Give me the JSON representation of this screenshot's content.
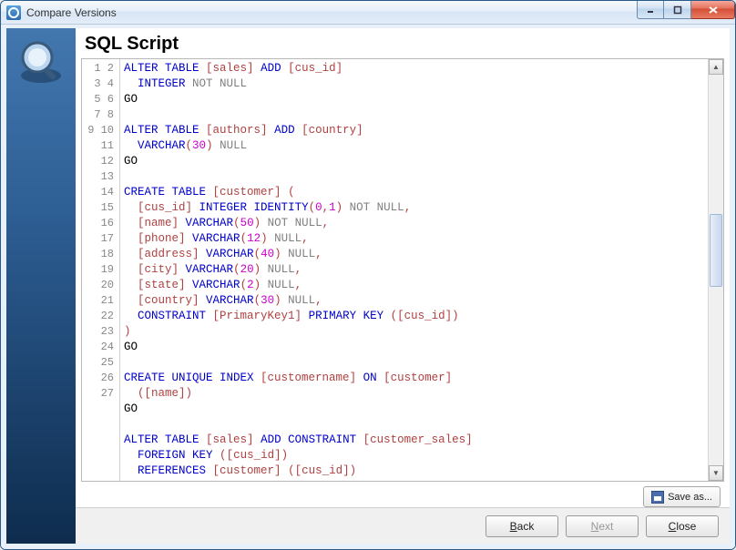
{
  "window": {
    "title": "Compare Versions"
  },
  "heading": "SQL Script",
  "buttons": {
    "save_as": "Save as...",
    "back": "Back",
    "next": "Next",
    "close": "Close"
  },
  "code_lines": [
    [
      [
        "kw",
        "ALTER TABLE"
      ],
      [
        "",
        " "
      ],
      [
        "br",
        "[sales]"
      ],
      [
        "",
        " "
      ],
      [
        "kw",
        "ADD"
      ],
      [
        "",
        " "
      ],
      [
        "br",
        "[cus_id]"
      ]
    ],
    [
      [
        "",
        "  "
      ],
      [
        "kw",
        "INTEGER"
      ],
      [
        "",
        " "
      ],
      [
        "gray",
        "NOT NULL"
      ]
    ],
    [
      [
        "",
        "GO"
      ]
    ],
    [],
    [
      [
        "kw",
        "ALTER TABLE"
      ],
      [
        "",
        " "
      ],
      [
        "br",
        "[authors]"
      ],
      [
        "",
        " "
      ],
      [
        "kw",
        "ADD"
      ],
      [
        "",
        " "
      ],
      [
        "br",
        "[country]"
      ]
    ],
    [
      [
        "",
        "  "
      ],
      [
        "kw",
        "VARCHAR"
      ],
      [
        "op",
        "("
      ],
      [
        "num",
        "30"
      ],
      [
        "op",
        ")"
      ],
      [
        "",
        " "
      ],
      [
        "gray",
        "NULL"
      ]
    ],
    [
      [
        "",
        "GO"
      ]
    ],
    [],
    [
      [
        "kw",
        "CREATE TABLE"
      ],
      [
        "",
        " "
      ],
      [
        "br",
        "[customer]"
      ],
      [
        "",
        " "
      ],
      [
        "op",
        "("
      ]
    ],
    [
      [
        "",
        "  "
      ],
      [
        "br",
        "[cus_id]"
      ],
      [
        "",
        " "
      ],
      [
        "kw",
        "INTEGER IDENTITY"
      ],
      [
        "op",
        "("
      ],
      [
        "num",
        "0"
      ],
      [
        "op",
        ","
      ],
      [
        "num",
        "1"
      ],
      [
        "op",
        ")"
      ],
      [
        "",
        " "
      ],
      [
        "gray",
        "NOT NULL"
      ],
      [
        "op",
        ","
      ]
    ],
    [
      [
        "",
        "  "
      ],
      [
        "br",
        "[name]"
      ],
      [
        "",
        " "
      ],
      [
        "kw",
        "VARCHAR"
      ],
      [
        "op",
        "("
      ],
      [
        "num",
        "50"
      ],
      [
        "op",
        ")"
      ],
      [
        "",
        " "
      ],
      [
        "gray",
        "NOT NULL"
      ],
      [
        "op",
        ","
      ]
    ],
    [
      [
        "",
        "  "
      ],
      [
        "br",
        "[phone]"
      ],
      [
        "",
        " "
      ],
      [
        "kw",
        "VARCHAR"
      ],
      [
        "op",
        "("
      ],
      [
        "num",
        "12"
      ],
      [
        "op",
        ")"
      ],
      [
        "",
        " "
      ],
      [
        "gray",
        "NULL"
      ],
      [
        "op",
        ","
      ]
    ],
    [
      [
        "",
        "  "
      ],
      [
        "br",
        "[address]"
      ],
      [
        "",
        " "
      ],
      [
        "kw",
        "VARCHAR"
      ],
      [
        "op",
        "("
      ],
      [
        "num",
        "40"
      ],
      [
        "op",
        ")"
      ],
      [
        "",
        " "
      ],
      [
        "gray",
        "NULL"
      ],
      [
        "op",
        ","
      ]
    ],
    [
      [
        "",
        "  "
      ],
      [
        "br",
        "[city]"
      ],
      [
        "",
        " "
      ],
      [
        "kw",
        "VARCHAR"
      ],
      [
        "op",
        "("
      ],
      [
        "num",
        "20"
      ],
      [
        "op",
        ")"
      ],
      [
        "",
        " "
      ],
      [
        "gray",
        "NULL"
      ],
      [
        "op",
        ","
      ]
    ],
    [
      [
        "",
        "  "
      ],
      [
        "br",
        "[state]"
      ],
      [
        "",
        " "
      ],
      [
        "kw",
        "VARCHAR"
      ],
      [
        "op",
        "("
      ],
      [
        "num",
        "2"
      ],
      [
        "op",
        ")"
      ],
      [
        "",
        " "
      ],
      [
        "gray",
        "NULL"
      ],
      [
        "op",
        ","
      ]
    ],
    [
      [
        "",
        "  "
      ],
      [
        "br",
        "[country]"
      ],
      [
        "",
        " "
      ],
      [
        "kw",
        "VARCHAR"
      ],
      [
        "op",
        "("
      ],
      [
        "num",
        "30"
      ],
      [
        "op",
        ")"
      ],
      [
        "",
        " "
      ],
      [
        "gray",
        "NULL"
      ],
      [
        "op",
        ","
      ]
    ],
    [
      [
        "",
        "  "
      ],
      [
        "kw",
        "CONSTRAINT"
      ],
      [
        "",
        " "
      ],
      [
        "br",
        "[PrimaryKey1]"
      ],
      [
        "",
        " "
      ],
      [
        "kw",
        "PRIMARY KEY"
      ],
      [
        "",
        " "
      ],
      [
        "op",
        "("
      ],
      [
        "br",
        "[cus_id]"
      ],
      [
        "op",
        ")"
      ]
    ],
    [
      [
        "op",
        ")"
      ]
    ],
    [
      [
        "",
        "GO"
      ]
    ],
    [],
    [
      [
        "kw",
        "CREATE UNIQUE INDEX"
      ],
      [
        "",
        " "
      ],
      [
        "br",
        "[customername]"
      ],
      [
        "",
        " "
      ],
      [
        "kw",
        "ON"
      ],
      [
        "",
        " "
      ],
      [
        "br",
        "[customer]"
      ]
    ],
    [
      [
        "",
        "  "
      ],
      [
        "op",
        "("
      ],
      [
        "br",
        "[name]"
      ],
      [
        "op",
        ")"
      ]
    ],
    [
      [
        "",
        "GO"
      ]
    ],
    [],
    [
      [
        "kw",
        "ALTER TABLE"
      ],
      [
        "",
        " "
      ],
      [
        "br",
        "[sales]"
      ],
      [
        "",
        " "
      ],
      [
        "kw",
        "ADD CONSTRAINT"
      ],
      [
        "",
        " "
      ],
      [
        "br",
        "[customer_sales]"
      ]
    ],
    [
      [
        "",
        "  "
      ],
      [
        "kw",
        "FOREIGN KEY"
      ],
      [
        "",
        " "
      ],
      [
        "op",
        "("
      ],
      [
        "br",
        "[cus_id]"
      ],
      [
        "op",
        ")"
      ]
    ],
    [
      [
        "",
        "  "
      ],
      [
        "kw",
        "REFERENCES"
      ],
      [
        "",
        " "
      ],
      [
        "br",
        "[customer]"
      ],
      [
        "",
        " "
      ],
      [
        "op",
        "("
      ],
      [
        "br",
        "[cus_id]"
      ],
      [
        "op",
        ")"
      ]
    ]
  ]
}
